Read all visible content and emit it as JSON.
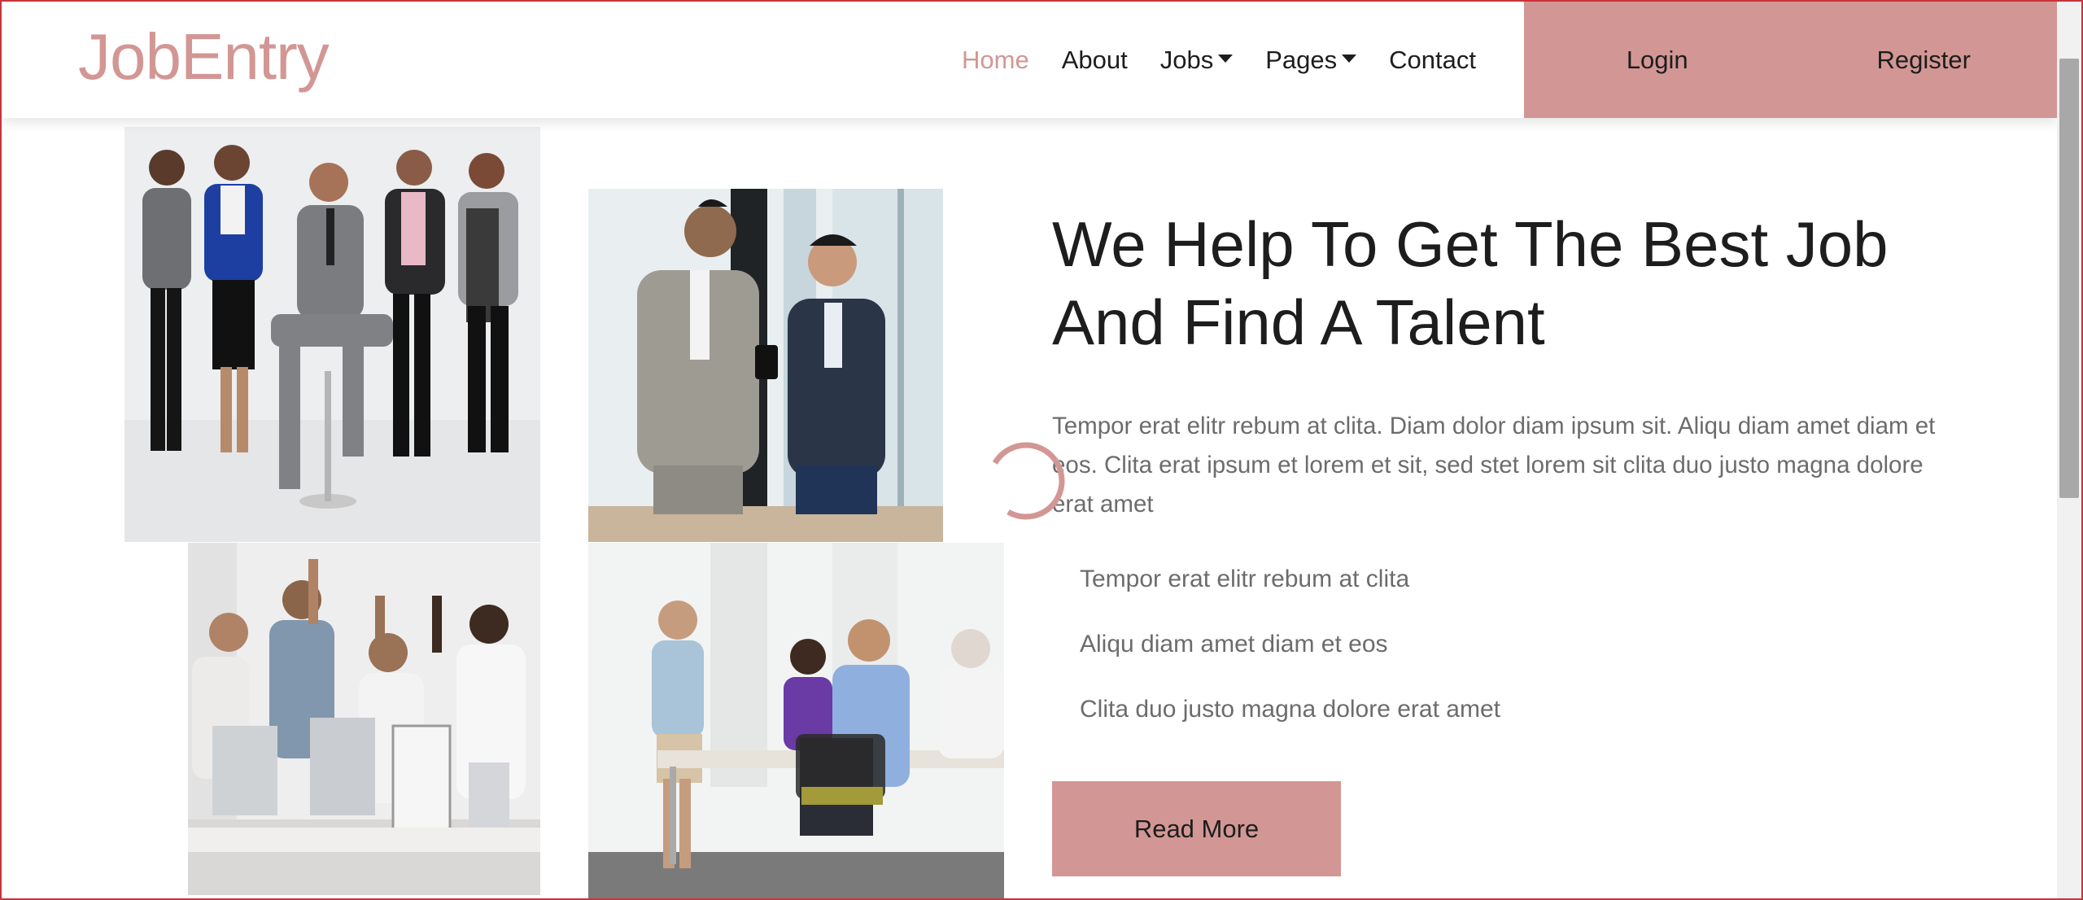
{
  "brand": {
    "name": "JobEntry"
  },
  "nav": {
    "links": [
      {
        "label": "Home",
        "active": true
      },
      {
        "label": "About",
        "active": false
      },
      {
        "label": "Jobs",
        "dropdown": true
      },
      {
        "label": "Pages",
        "dropdown": true
      },
      {
        "label": "Contact",
        "active": false
      }
    ],
    "login": "Login",
    "register": "Register"
  },
  "hero": {
    "title_line1": "We Help To Get The Best Job",
    "title_line2": "And Find A Talent",
    "description": "Tempor erat elitr rebum at clita. Diam dolor diam ipsum sit. Aliqu diam amet diam et eos. Clita erat ipsum et lorem et sit, sed stet lorem sit clita duo justo magna dolore erat amet",
    "features": [
      "Tempor erat elitr rebum at clita",
      "Aliqu diam amet diam et eos",
      "Clita duo justo magna dolore erat amet"
    ],
    "button": "Read More"
  },
  "images": [
    {
      "name": "team-group-photo"
    },
    {
      "name": "two-men-phone-photo"
    },
    {
      "name": "office-celebration-photo"
    },
    {
      "name": "meeting-presentation-photo"
    }
  ],
  "colors": {
    "accent": "#d29794",
    "text_dark": "#1d1d1d",
    "text_muted": "#6c6c6c"
  },
  "icons": {
    "loading": "spinner-icon",
    "dropdown": "caret-down-icon"
  }
}
